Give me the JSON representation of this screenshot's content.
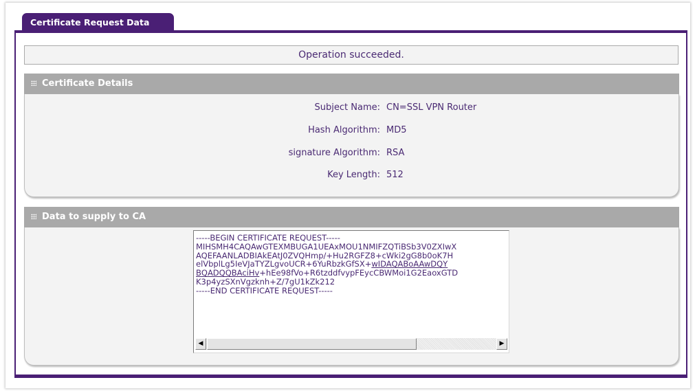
{
  "tab": {
    "label": "Certificate Request Data"
  },
  "status": {
    "message": "Operation succeeded."
  },
  "certificate_details": {
    "header": "Certificate Details",
    "rows": [
      {
        "label": "Subject Name:",
        "value": "CN=SSL VPN Router"
      },
      {
        "label": "Hash Algorithm:",
        "value": "MD5"
      },
      {
        "label": "signature Algorithm:",
        "value": "RSA"
      },
      {
        "label": "Key Length:",
        "value": "512"
      }
    ]
  },
  "data_to_ca": {
    "header": "Data to supply to CA",
    "lines": [
      "-----BEGIN CERTIFICATE REQUEST-----",
      "MIHSMH4CAQAwGTEXMBUGA1UEAxMOU1NMIFZQTiBSb3V0ZXIwX",
      "AQEFAANLADBIAkEAtJ0ZVQHmp/+Hu2RGFZ8+cWki2gG8b0oK7H",
      "elVbplLg5IeVJaTYZLgvoUCR+6YuRbzkGfSX+",
      "wIDAQABoAAwDQY",
      "BQADQQBAciHv",
      "+hEe98fVo+R6tzddfvypFEycCBWMoi1G2EaoxGTD",
      "K3p4yzSXnVgzknh+Z/7gU1kZk212",
      "-----END CERTIFICATE REQUEST-----"
    ]
  },
  "icons": {
    "section_grip": "grip-icon",
    "scroll_left": "arrow-left-icon",
    "scroll_right": "arrow-right-icon"
  },
  "colors": {
    "accent": "#4a1f75",
    "header_gray": "#a9a9a9",
    "panel_bg": "#f3f3f3",
    "text": "#4a2a73"
  }
}
